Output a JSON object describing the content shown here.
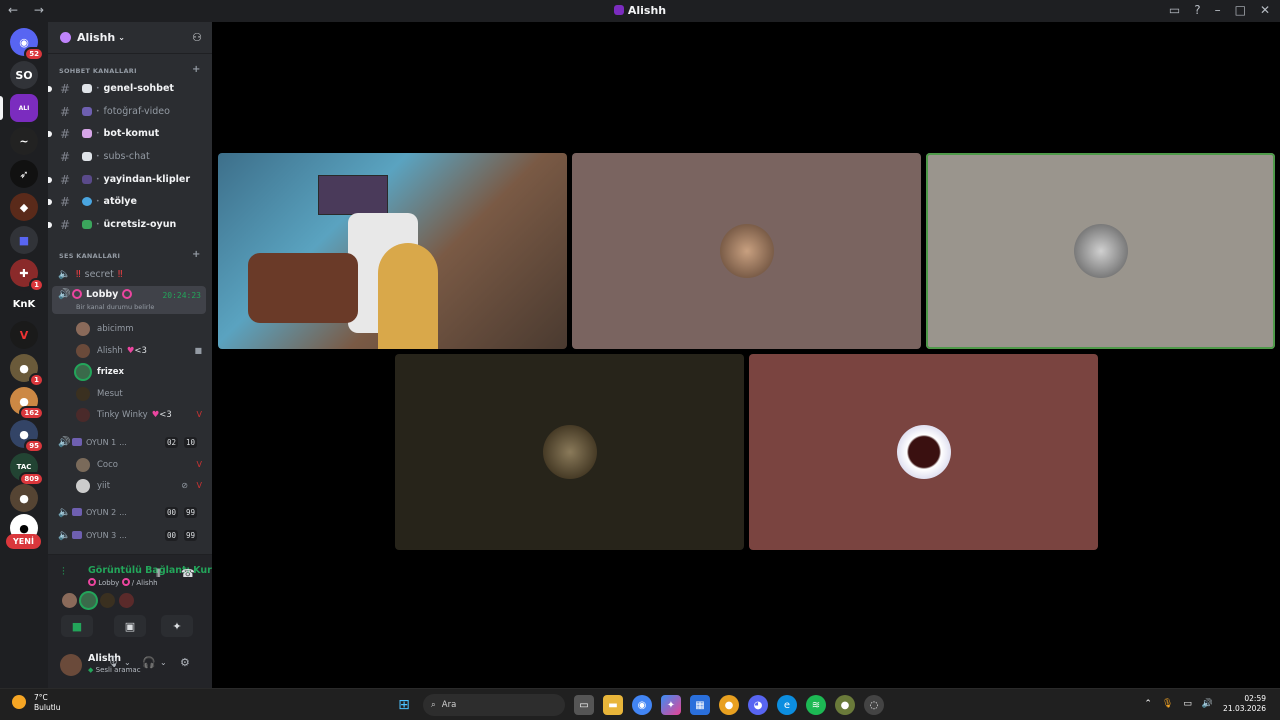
{
  "titlebar": {
    "title": "Alishh"
  },
  "server": {
    "name": "Alishh"
  },
  "guilds": {
    "so_label": "SO",
    "knk_label": "KnK",
    "new_label": "YENİ",
    "badges": [
      "52",
      "1",
      "1",
      "162",
      "95",
      "809"
    ]
  },
  "text_category": "SOHBET KANALLARI",
  "text_channels": [
    {
      "name": "genel-sohbet"
    },
    {
      "name": "fotoğraf-video"
    },
    {
      "name": "bot-komut"
    },
    {
      "name": "subs-chat"
    },
    {
      "name": "yayindan-klipler"
    },
    {
      "name": "atölye"
    },
    {
      "name": "ücretsiz-oyun"
    }
  ],
  "voice_category": "SES KANALLARI",
  "voice": {
    "secret": "secret",
    "lobby": {
      "name": "Lobby",
      "timer": "20:24:23",
      "status": "Bir kanal durumu belirle"
    },
    "lobby_members": [
      {
        "name": "abicimm"
      },
      {
        "name": "Alishh",
        "suffix": "<3"
      },
      {
        "name": "frizex"
      },
      {
        "name": "Mesut"
      },
      {
        "name": "Tinky Winky",
        "suffix": "<3"
      }
    ],
    "oyun1": {
      "name": "OYUN 1",
      "a": "02",
      "b": "10"
    },
    "oyun1_members": [
      {
        "name": "Coco"
      },
      {
        "name": "yiit"
      }
    ],
    "oyun2": {
      "name": "OYUN 2",
      "a": "00",
      "b": "99"
    },
    "oyun3": {
      "name": "OYUN 3",
      "a": "00",
      "b": "99"
    }
  },
  "voice_panel": {
    "title": "Görüntülü Bağlantı Kur",
    "location_channel": "Lobby",
    "location_server": "/ Alishh"
  },
  "user": {
    "name": "Alishh",
    "status": "Sesli aramac"
  },
  "taskbar": {
    "temp": "7°C",
    "cond": "Bulutlu",
    "search": "Ara",
    "time": "02:59",
    "date": "21.03.2026"
  },
  "colors": {
    "tile2": "#7a6460",
    "tile3": "#9a958d",
    "tile4": "#27241a",
    "tile5": "#7a4440",
    "speaking": "#4f9a4a"
  }
}
